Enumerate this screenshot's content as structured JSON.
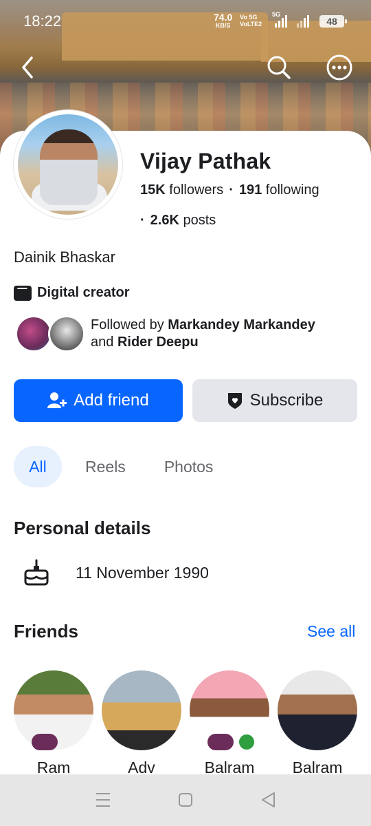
{
  "status_bar": {
    "time": "18:22",
    "net_speed": "74.0",
    "net_unit": "KB/S",
    "volte1": "Vo 5G",
    "volte2": "VoLTE2",
    "net_type": "5G",
    "battery": "48"
  },
  "profile": {
    "name": "Vijay Pathak",
    "followers_count": "15K",
    "followers_label": "followers",
    "following_count": "191",
    "following_label": "following",
    "posts_count": "2.6K",
    "posts_label": "posts",
    "bio": "Dainik Bhaskar",
    "category": "Digital creator",
    "followed_by_prefix": "Followed by",
    "followed_by_1": "Markandey Markandey",
    "followed_by_and": "and",
    "followed_by_2": "Rider Deepu"
  },
  "actions": {
    "add_friend": "Add friend",
    "subscribe": "Subscribe"
  },
  "tabs": [
    {
      "label": "All",
      "active": true
    },
    {
      "label": "Reels",
      "active": false
    },
    {
      "label": "Photos",
      "active": false
    }
  ],
  "personal_details": {
    "title": "Personal details",
    "birthday": "11 November 1990"
  },
  "friends": {
    "title": "Friends",
    "see_all": "See all",
    "items": [
      {
        "name": "Ram"
      },
      {
        "name": "Adv"
      },
      {
        "name": "Balram"
      },
      {
        "name": "Balram"
      }
    ]
  },
  "colors": {
    "accent": "#0866ff",
    "secondary_button": "#e4e6eb",
    "active_tab_bg": "#e7f0fd"
  }
}
